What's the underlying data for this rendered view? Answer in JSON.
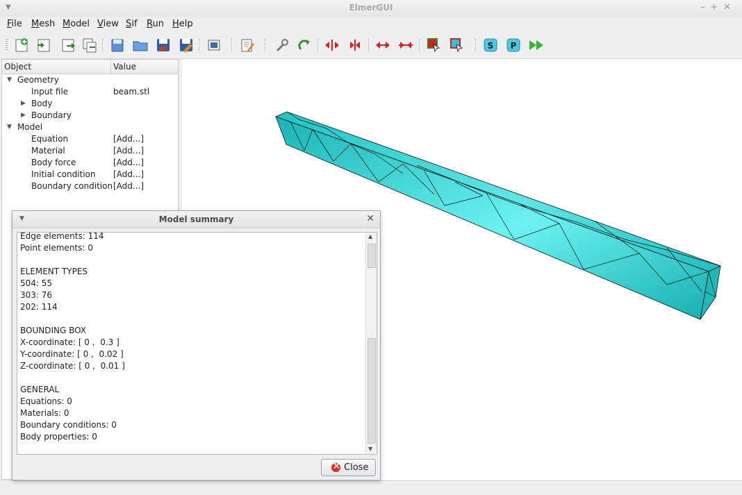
{
  "window": {
    "title": "ElmerGUI"
  },
  "menu": [
    "File",
    "Mesh",
    "Model",
    "View",
    "Sif",
    "Run",
    "Help"
  ],
  "toolbar": {
    "icons": [
      "new-icon",
      "open-mesh-icon",
      "load-mesh-icon",
      "save-mesh-icon",
      "open-file-icon",
      "open-folder-icon",
      "save-icon",
      "save-as-icon",
      "screenshot-icon",
      "edit-sif-icon",
      "settings-wrench-icon",
      "redo-icon",
      "divide-surface-icon",
      "unify-surface-icon",
      "divide-edge-icon",
      "unify-edge-icon",
      "select-surface-icon",
      "select-edge-icon",
      "start-solver-icon",
      "postprocessor-icon",
      "run-all-icon"
    ]
  },
  "tree": {
    "col_object": "Object",
    "col_value": "Value",
    "rows": [
      {
        "label": "Geometry",
        "value": ""
      },
      {
        "label": "Input file",
        "value": "beam.stl"
      },
      {
        "label": "Body",
        "value": ""
      },
      {
        "label": "Boundary",
        "value": ""
      },
      {
        "label": "Model",
        "value": ""
      },
      {
        "label": "Equation",
        "value": "[Add...]"
      },
      {
        "label": "Material",
        "value": "[Add...]"
      },
      {
        "label": "Body force",
        "value": "[Add...]"
      },
      {
        "label": "Initial condition",
        "value": "[Add...]"
      },
      {
        "label": "Boundary condition",
        "value": "[Add...]"
      }
    ]
  },
  "dialog": {
    "title": "Model summary",
    "text": "Edge elements: 114\nPoint elements: 0\n\nELEMENT TYPES\n504: 55\n303: 76\n202: 114\n\nBOUNDING BOX\nX-coordinate: [ 0 ,  0.3 ]\nY-coordinate: [ 0 ,  0.02 ]\nZ-coordinate: [ 0 ,  0.01 ]\n\nGENERAL\nEquations: 0\nMaterials: 0\nBoundary conditions: 0\nBody properties: 0",
    "close_label": "Close"
  },
  "colors": {
    "mesh_fill": "#3ec8c8",
    "mesh_dark": "#1aa8a8",
    "mesh_light": "#7ef2f2"
  }
}
